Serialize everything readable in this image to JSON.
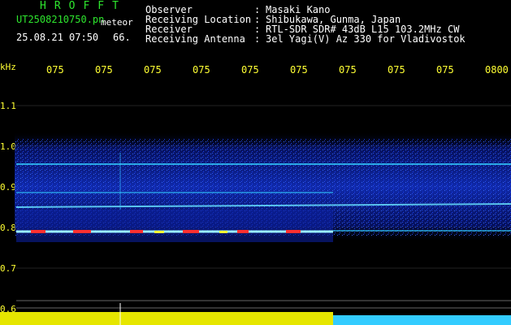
{
  "header": {
    "brand": "HROFFT",
    "filename": "UT2508210750.pn",
    "file_note": "meteor",
    "datetime": "25.08.21 07:50",
    "freq_hint": "66.",
    "fields": [
      {
        "label": "Observer",
        "value": "Masaki Kano"
      },
      {
        "label": "Receiving Location",
        "value": "Shibukawa, Gunma, Japan"
      },
      {
        "label": "Receiver",
        "value": "RTL-SDR SDR# 43dB L15 103.2MHz CW"
      },
      {
        "label": "Receiving Antenna",
        "value": "3el Yagi(V) Az 330 for Vladivostok"
      }
    ],
    "separator": ":"
  },
  "axis": {
    "unit": "kHz",
    "time_ticks": [
      "075",
      "075",
      "075",
      "075",
      "075",
      "075",
      "075",
      "075",
      "075",
      "0800"
    ],
    "freq_ticks": [
      "1.1",
      "1.0",
      "0.9",
      "0.8",
      "0.7",
      "0.6"
    ]
  },
  "colors": {
    "text_green": "#2ee62e",
    "text_white": "#ffffff",
    "text_yellow": "#ffff33",
    "noise_blue": "#1a3cff",
    "band_cyan": "#33ccff",
    "signal_red": "#ff3030"
  }
}
